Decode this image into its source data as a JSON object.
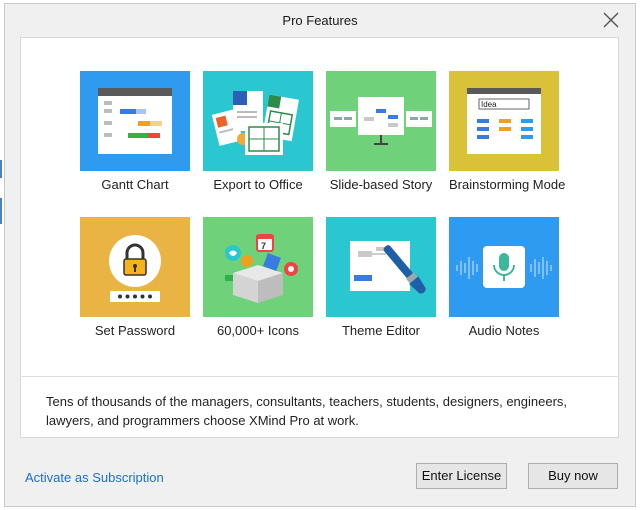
{
  "window": {
    "title": "Pro Features",
    "close_label": "Close"
  },
  "features": [
    {
      "label": "Gantt Chart",
      "icon": "gantt-chart-icon",
      "bg": "#2e9bf0"
    },
    {
      "label": "Export to Office",
      "icon": "export-office-icon",
      "bg": "#2bc7d1"
    },
    {
      "label": "Slide-based Story",
      "icon": "slide-story-icon",
      "bg": "#6fd27a"
    },
    {
      "label": "Brainstorming Mode",
      "icon": "brainstorm-icon",
      "bg": "#d9c23a"
    },
    {
      "label": "Set Password",
      "icon": "padlock-icon",
      "bg": "#e9b443"
    },
    {
      "label": "60,000+ Icons",
      "icon": "icon-box-icon",
      "bg": "#6fd27a"
    },
    {
      "label": "Theme Editor",
      "icon": "paintbrush-icon",
      "bg": "#2bc7d1"
    },
    {
      "label": "Audio Notes",
      "icon": "microphone-icon",
      "bg": "#2e9bf0"
    }
  ],
  "thumb_text": {
    "idea": "Idea"
  },
  "description": "Tens of thousands of the managers, consultants, teachers, students, designers, engineers, lawyers, and programmers choose XMind Pro at work.",
  "footer": {
    "activate_link": "Activate as Subscription",
    "enter_license": "Enter License",
    "buy_now": "Buy now"
  }
}
